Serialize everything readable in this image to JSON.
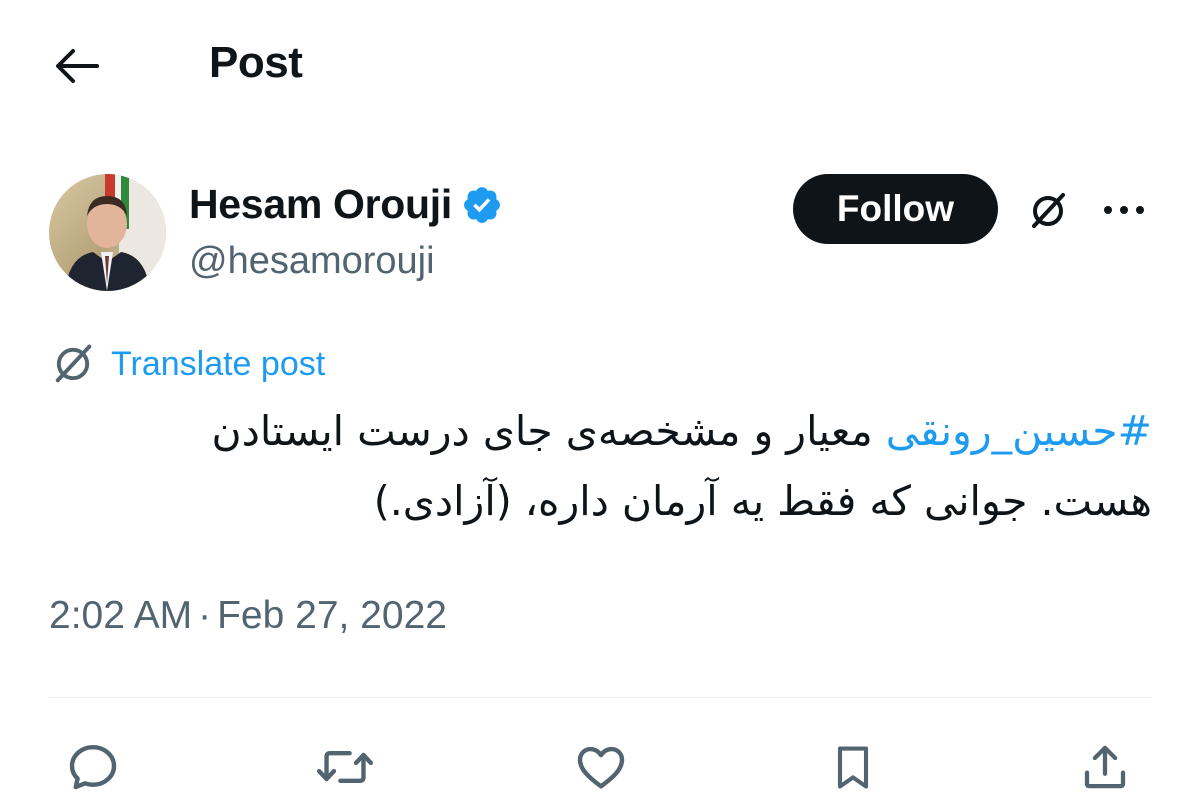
{
  "header": {
    "title": "Post",
    "back_icon": "arrow-left-icon"
  },
  "author": {
    "display_name": "Hesam Orouji",
    "handle": "@hesamorouji",
    "verified": true,
    "verified_color": "#1d9bf0",
    "avatar": "profile-photo"
  },
  "actions_top": {
    "follow_label": "Follow",
    "grok_icon": "grok-icon",
    "more_icon": "more-horizontal-icon"
  },
  "translate": {
    "label": "Translate post",
    "icon": "grok-icon"
  },
  "post": {
    "hashtag": "#حسین_رونقی",
    "text_after_hashtag": " معیار و مشخصه‌ی جای درست ایستادن هست. جوانی که فقط یه آرمان داره، (آزادی.)"
  },
  "meta": {
    "time": "2:02 AM",
    "separator": "·",
    "date": "Feb 27, 2022"
  },
  "engagement": {
    "icons": [
      "reply-icon",
      "repost-icon",
      "like-icon",
      "bookmark-icon",
      "share-icon"
    ]
  },
  "colors": {
    "text": "#0f1419",
    "secondary": "#536471",
    "accent": "#1d9bf0",
    "follow_bg": "#0f1419"
  }
}
